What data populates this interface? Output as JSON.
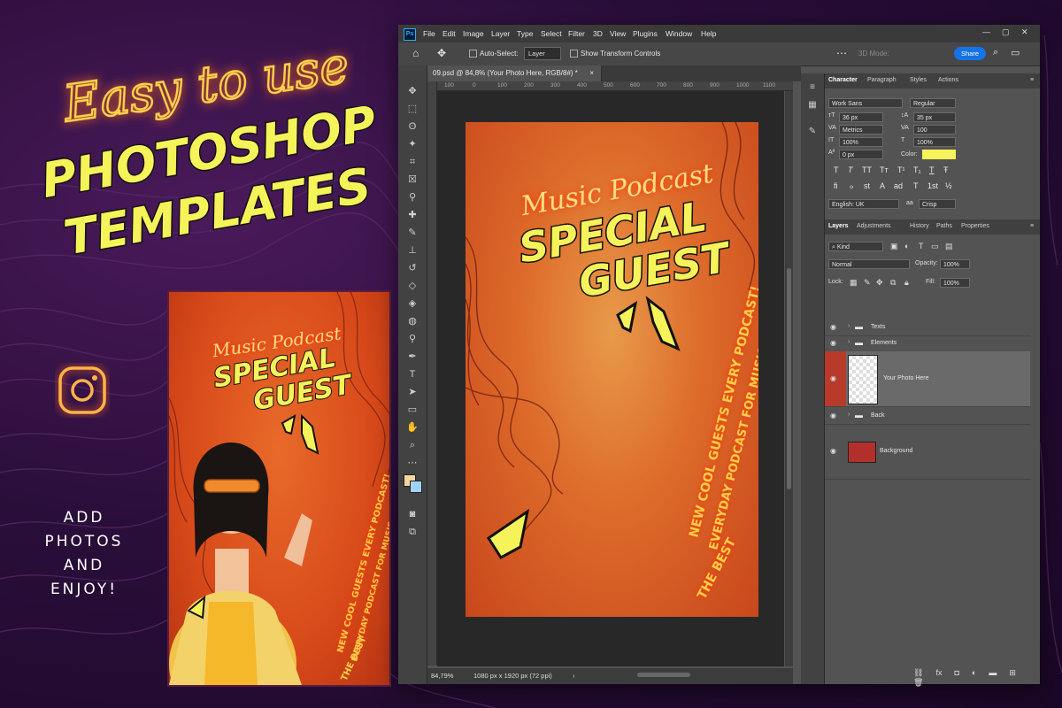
{
  "promo": {
    "script_title": "Easy to use",
    "headline_line1": "PHOTOSHOP",
    "headline_line2": "TEMPLATES",
    "add_photos_lines": [
      "ADD",
      "PHOTOS",
      "AND",
      "ENJOY!"
    ]
  },
  "poster": {
    "script": "Music Podcast",
    "title_line1": "SPECIAL",
    "title_line2": "GUEST",
    "curved_line1": "NEW COOL GUESTS  EVERY PODCAST!",
    "curved_line2": "EVERYDAY PODCAST FOR MUSIC LOVERS",
    "curved_line3": "THE BEST"
  },
  "app": {
    "menu": [
      "File",
      "Edit",
      "Image",
      "Layer",
      "Type",
      "Select",
      "Filter",
      "3D",
      "View",
      "Plugins",
      "Window",
      "Help"
    ],
    "options": {
      "auto_select_label": "Auto-Select:",
      "auto_select_value": "Layer",
      "transform_label": "Show Transform Controls",
      "mode_3d": "3D Mode:",
      "share": "Share"
    },
    "doc_tab": "09.psd @ 84,8% (Your Photo Here, RGB/8#) *",
    "ruler_marks": [
      "100",
      "0",
      "100",
      "200",
      "300",
      "400",
      "500",
      "600",
      "700",
      "800",
      "900",
      "1000",
      "1100"
    ],
    "status": {
      "zoom": "84,79%",
      "doc_info": "1080 px x 1920 px (72 ppi)"
    }
  },
  "character_panel": {
    "tabs": [
      "Character",
      "Paragraph",
      "Styles",
      "Actions"
    ],
    "font_family": "Work Sans",
    "font_style": "Regular",
    "size": "36 px",
    "leading": "35 px",
    "kerning": "Metrics",
    "tracking": "100",
    "vscale": "100%",
    "hscale": "100%",
    "baseline": "0 px",
    "color_label": "Color:",
    "color_value": "#f6f35a",
    "style_glyphs": [
      "T",
      "T",
      "TT",
      "Tт",
      "T¹",
      "T₁",
      "T",
      "Ŧ"
    ],
    "opentype_glyphs": [
      "fi",
      "ℴ",
      "st",
      "A",
      "ad",
      "T",
      "1st",
      "½"
    ],
    "language": "English: UK",
    "antialias": "Crisp"
  },
  "layers_panel": {
    "tabs": [
      "Layers",
      "Adjustments",
      "History",
      "Paths",
      "Properties"
    ],
    "filter_kind": "Kind",
    "blend_mode": "Normal",
    "opacity_label": "Opacity:",
    "opacity": "100%",
    "lock_label": "Lock:",
    "fill_label": "Fill:",
    "fill": "100%",
    "layers": [
      {
        "name": "Texts",
        "type": "group"
      },
      {
        "name": "Elements",
        "type": "group"
      },
      {
        "name": "Your Photo Here",
        "type": "smart",
        "selected": true
      },
      {
        "name": "Back",
        "type": "group"
      },
      {
        "name": "Background",
        "type": "raster"
      }
    ]
  },
  "colors": {
    "neon_yellow": "#f6f35a",
    "neon_red": "#ff3a1a",
    "orange_bg": "#dd6a2a",
    "share_blue": "#1473e6"
  }
}
